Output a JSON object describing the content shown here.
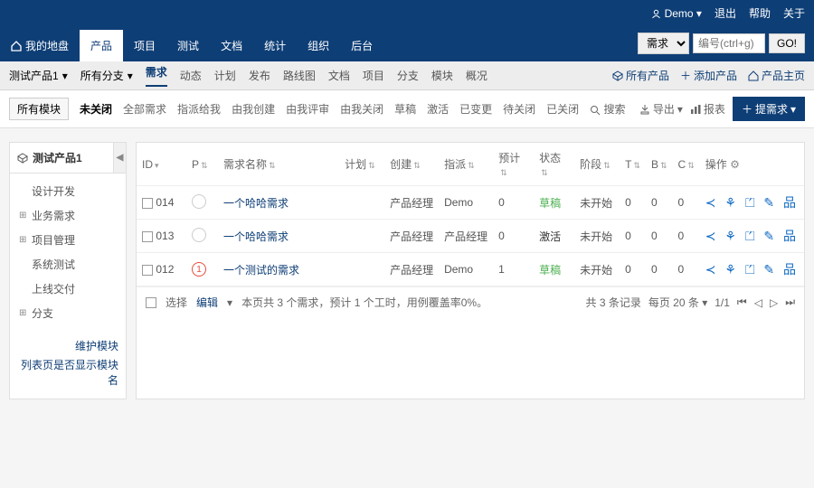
{
  "header": {
    "user": "Demo",
    "links": [
      "退出",
      "帮助",
      "关于"
    ],
    "tabs": [
      "我的地盘",
      "产品",
      "项目",
      "测试",
      "文档",
      "统计",
      "组织",
      "后台"
    ],
    "active_tab": 1,
    "search_type": "需求",
    "search_placeholder": "编号(ctrl+g)",
    "search_button": "GO!"
  },
  "subnav": {
    "product": "测试产品1",
    "branch": "所有分支",
    "items": [
      "需求",
      "动态",
      "计划",
      "发布",
      "路线图",
      "文档",
      "项目",
      "分支",
      "模块",
      "概况"
    ],
    "active_item": 0,
    "right": {
      "all_products": "所有产品",
      "add_product": "添加产品",
      "product_home": "产品主页"
    }
  },
  "filters": {
    "module_chip": "所有模块",
    "items": [
      "未关闭",
      "全部需求",
      "指派给我",
      "由我创建",
      "由我评审",
      "由我关闭",
      "草稿",
      "激活",
      "已变更",
      "待关闭",
      "已关闭"
    ],
    "active_item": 0,
    "search": "搜索",
    "right": {
      "export": "导出",
      "report": "报表",
      "submit": "提需求"
    }
  },
  "sidebar": {
    "title": "测试产品1",
    "nodes": [
      {
        "label": "设计开发",
        "expandable": false
      },
      {
        "label": "业务需求",
        "expandable": true
      },
      {
        "label": "项目管理",
        "expandable": true
      },
      {
        "label": "系统测试",
        "expandable": false
      },
      {
        "label": "上线交付",
        "expandable": false
      },
      {
        "label": "分支",
        "expandable": true
      }
    ],
    "footer": [
      "维护模块",
      "列表页是否显示模块名"
    ]
  },
  "table": {
    "columns": [
      "ID",
      "P",
      "需求名称",
      "计划",
      "创建",
      "指派",
      "预计",
      "状态",
      "阶段",
      "T",
      "B",
      "C",
      "操作"
    ],
    "rows": [
      {
        "id": "014",
        "p": "",
        "p_class": "",
        "title": "一个哈哈需求",
        "plan": "",
        "creator": "产品经理",
        "assignee": "Demo",
        "estimate": "0",
        "status": "草稿",
        "status_class": "status-draft",
        "phase": "未开始",
        "t": "0",
        "b": "0",
        "c": "0"
      },
      {
        "id": "013",
        "p": "",
        "p_class": "",
        "title": "一个哈哈需求",
        "plan": "",
        "creator": "产品经理",
        "assignee": "产品经理",
        "estimate": "0",
        "status": "激活",
        "status_class": "status-active",
        "phase": "未开始",
        "t": "0",
        "b": "0",
        "c": "0"
      },
      {
        "id": "012",
        "p": "1",
        "p_class": "priority-1",
        "title": "一个测试的需求",
        "plan": "",
        "creator": "产品经理",
        "assignee": "Demo",
        "estimate": "1",
        "status": "草稿",
        "status_class": "status-draft",
        "phase": "未开始",
        "t": "0",
        "b": "0",
        "c": "0"
      }
    ],
    "footer": {
      "select": "选择",
      "edit": "编辑",
      "summary": "本页共 3 个需求，预计 1 个工时，用例覆盖率0%。",
      "pager_total": "共 3 条记录",
      "per_page": "每页 20 条",
      "page": "1/1"
    }
  }
}
